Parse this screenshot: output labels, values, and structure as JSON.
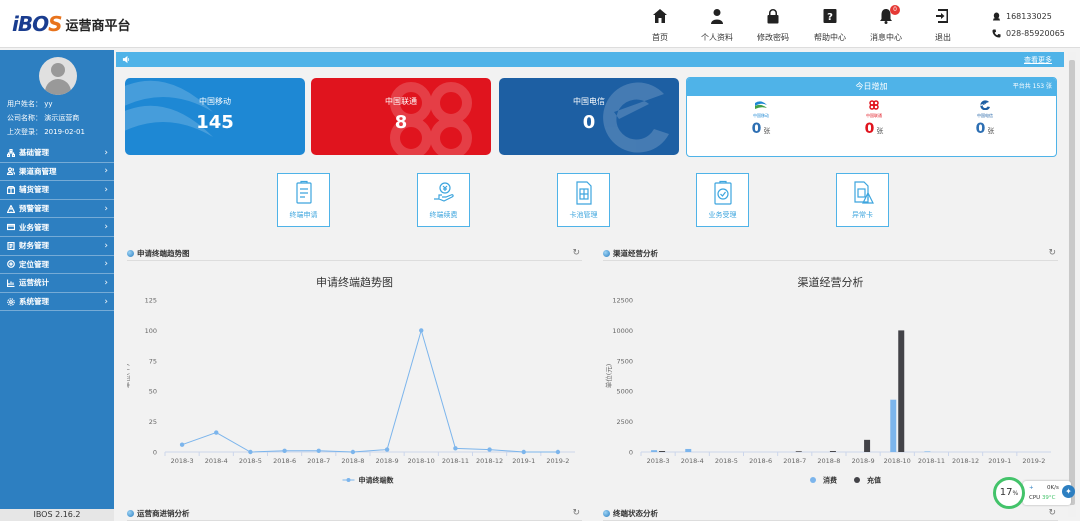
{
  "app": {
    "brand_prefix": "iBO",
    "brand_s": "S",
    "platform": "运营商平台"
  },
  "nav": [
    {
      "label": "首页",
      "icon": "home-icon"
    },
    {
      "label": "个人资料",
      "icon": "user-icon"
    },
    {
      "label": "修改密码",
      "icon": "lock-icon"
    },
    {
      "label": "帮助中心",
      "icon": "help-icon"
    },
    {
      "label": "消息中心",
      "icon": "bell-icon",
      "badge": "0"
    },
    {
      "label": "退出",
      "icon": "logout-icon"
    }
  ],
  "contact": {
    "qq": "168133025",
    "phone": "028-85920065"
  },
  "user": {
    "name": "用户姓名： yy",
    "company": "公司名称： 演示运营商",
    "last_login": "上次登录： 2019-02-01"
  },
  "menu": [
    "基础管理",
    "渠道商管理",
    "辅货管理",
    "预警管理",
    "业务管理",
    "财务管理",
    "定位管理",
    "运营统计",
    "系统管理"
  ],
  "version": "IBOS 2.16.2",
  "infobar": {
    "more": "查看更多"
  },
  "carriers": [
    {
      "name": "中国移动",
      "value": "145",
      "color": "#1e88d4"
    },
    {
      "name": "中国联通",
      "value": "8",
      "color": "#e0141e"
    },
    {
      "name": "中国电信",
      "value": "0",
      "color": "#1d5fa3"
    }
  ],
  "today": {
    "title": "今日增加",
    "total": "平台共 153 张",
    "items": [
      {
        "logo": "中国移动",
        "value": "0",
        "unit": "张"
      },
      {
        "logo": "中国联通",
        "value": "0",
        "unit": "张"
      },
      {
        "logo": "中国电信",
        "value": "0",
        "unit": "张"
      }
    ]
  },
  "quick_actions": [
    "终端申请",
    "终端续费",
    "卡池管理",
    "业务受理",
    "异常卡"
  ],
  "panels": {
    "terminal": {
      "title": "申请终端趋势图"
    },
    "channel": {
      "title": "渠道经营分析"
    },
    "operator": {
      "title": "运营商进销分析"
    },
    "status": {
      "title": "终端状态分析"
    }
  },
  "chart_data": [
    {
      "type": "line",
      "title": "申请终端趋势图",
      "ylabel": "单位(个)",
      "categories": [
        "2018-3",
        "2018-4",
        "2018-5",
        "2018-6",
        "2018-7",
        "2018-8",
        "2018-9",
        "2018-10",
        "2018-11",
        "2018-12",
        "2019-1",
        "2019-2"
      ],
      "ylim": [
        0,
        125
      ],
      "yticks": [
        0,
        25,
        50,
        75,
        100,
        125
      ],
      "series": [
        {
          "name": "申请终端数",
          "color": "#7cb5ec",
          "values": [
            6,
            16,
            0,
            1,
            1,
            0,
            2,
            100,
            3,
            2,
            0,
            0
          ]
        }
      ],
      "legend": "bottom",
      "grid": false
    },
    {
      "type": "bar",
      "title": "渠道经营分析",
      "ylabel": "单位(元)",
      "categories": [
        "2018-3",
        "2018-4",
        "2018-5",
        "2018-6",
        "2018-7",
        "2018-8",
        "2018-9",
        "2018-10",
        "2018-11",
        "2018-12",
        "2019-1",
        "2019-2"
      ],
      "ylim": [
        0,
        12500
      ],
      "yticks": [
        0,
        2500,
        5000,
        7500,
        10000,
        12500
      ],
      "series": [
        {
          "name": "消费",
          "color": "#7cb5ec",
          "values": [
            150,
            250,
            0,
            0,
            0,
            0,
            0,
            4300,
            50,
            0,
            0,
            0
          ]
        },
        {
          "name": "充值",
          "color": "#434348",
          "values": [
            80,
            0,
            0,
            0,
            60,
            80,
            1000,
            10000,
            0,
            0,
            0,
            0
          ]
        }
      ],
      "legend": "bottom",
      "grid": false
    }
  ],
  "cpu": {
    "percent": "17",
    "unit": "%",
    "net": "0K/s",
    "cpu_label": "CPU",
    "temp": "39°C"
  }
}
